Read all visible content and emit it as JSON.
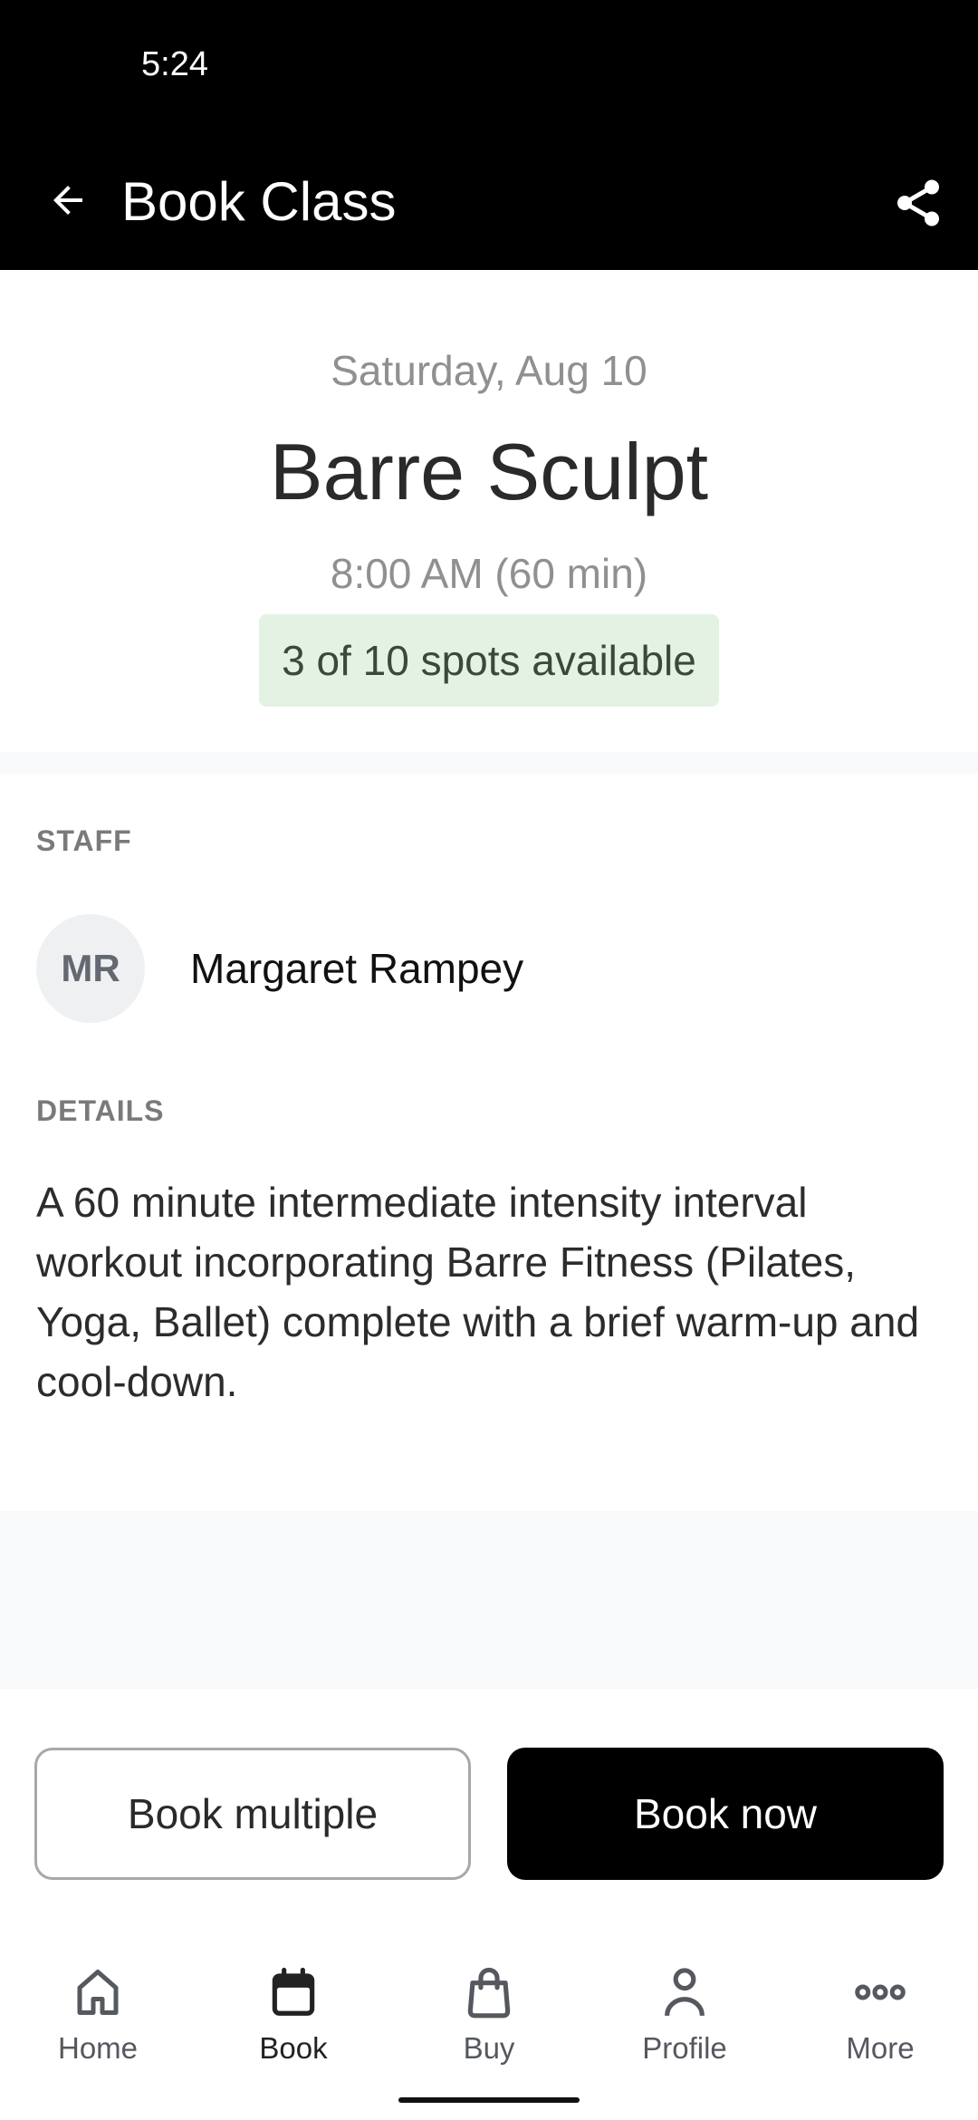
{
  "status_bar": {
    "time": "5:24"
  },
  "app_bar": {
    "title": "Book Class",
    "back_icon": "arrow-left-icon",
    "share_icon": "share-icon"
  },
  "class_info": {
    "date": "Saturday, Aug 10",
    "name": "Barre Sculpt",
    "time": "8:00 AM (60 min)",
    "spots": {
      "label": "3 of 10 spots available",
      "available": 3,
      "total": 10,
      "badge_color": "#e4f2e3"
    }
  },
  "staff": {
    "section_label": "STAFF",
    "initials": "MR",
    "name": "Margaret Rampey"
  },
  "details": {
    "section_label": "DETAILS",
    "description": "A 60 minute intermediate intensity interval workout incorporating Barre Fitness (Pilates, Yoga, Ballet) complete with a brief warm-up and cool-down."
  },
  "actions": {
    "book_multiple": "Book multiple",
    "book_now": "Book now"
  },
  "bottom_nav": {
    "active": "Book",
    "items": [
      {
        "label": "Home",
        "icon": "home-icon"
      },
      {
        "label": "Book",
        "icon": "calendar-icon"
      },
      {
        "label": "Buy",
        "icon": "shopping-bag-icon"
      },
      {
        "label": "Profile",
        "icon": "person-icon"
      },
      {
        "label": "More",
        "icon": "more-horizontal-icon"
      }
    ]
  }
}
